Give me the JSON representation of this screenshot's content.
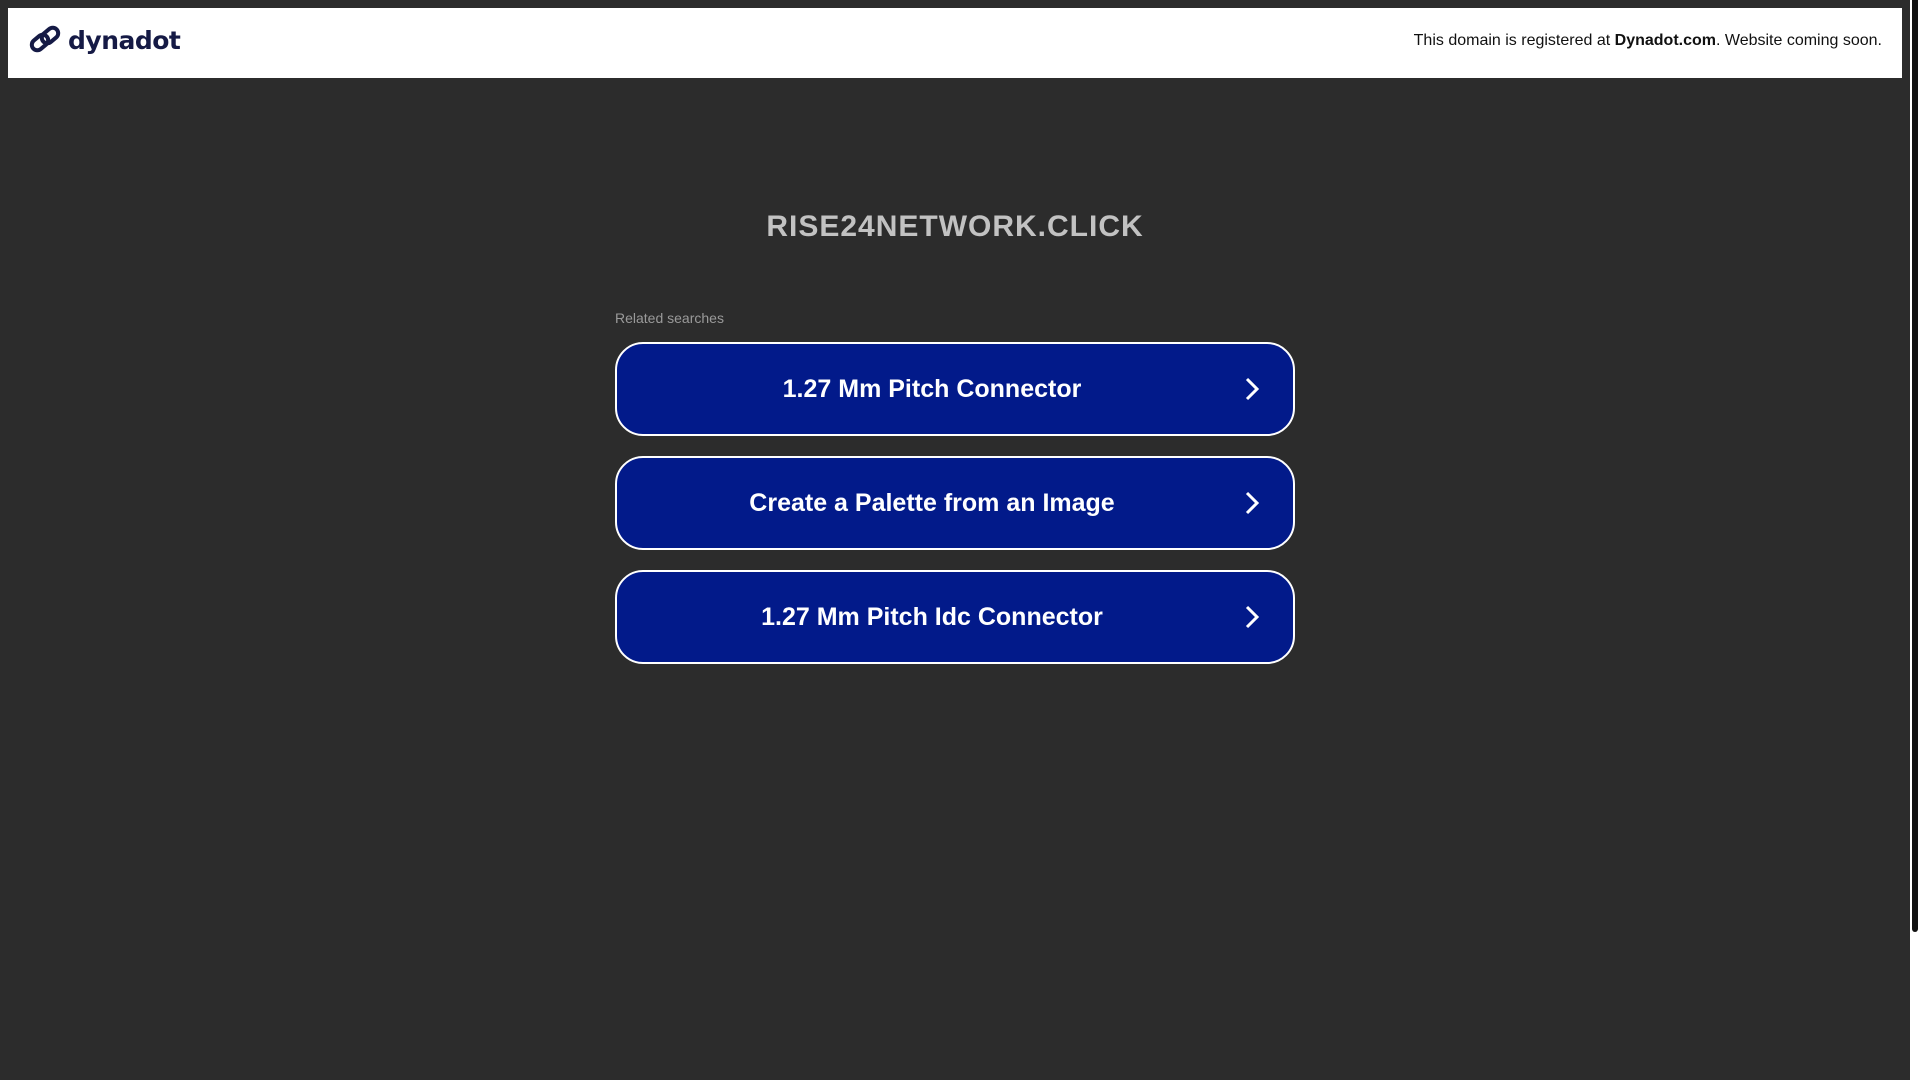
{
  "header": {
    "logo_text": "dynadot",
    "notice_prefix": "This domain is registered at ",
    "notice_brand": "Dynadot.com",
    "notice_suffix": ". Website coming soon."
  },
  "main": {
    "domain_title": "RISE24NETWORK.CLICK",
    "related_label": "Related searches",
    "searches": [
      {
        "label": "1.27 Mm Pitch Connector"
      },
      {
        "label": "Create a Palette from an Image"
      },
      {
        "label": "1.27 Mm Pitch Idc Connector"
      }
    ]
  },
  "colors": {
    "background": "#2c2c2c",
    "button": "#021a8a",
    "logo": "#151a45"
  }
}
